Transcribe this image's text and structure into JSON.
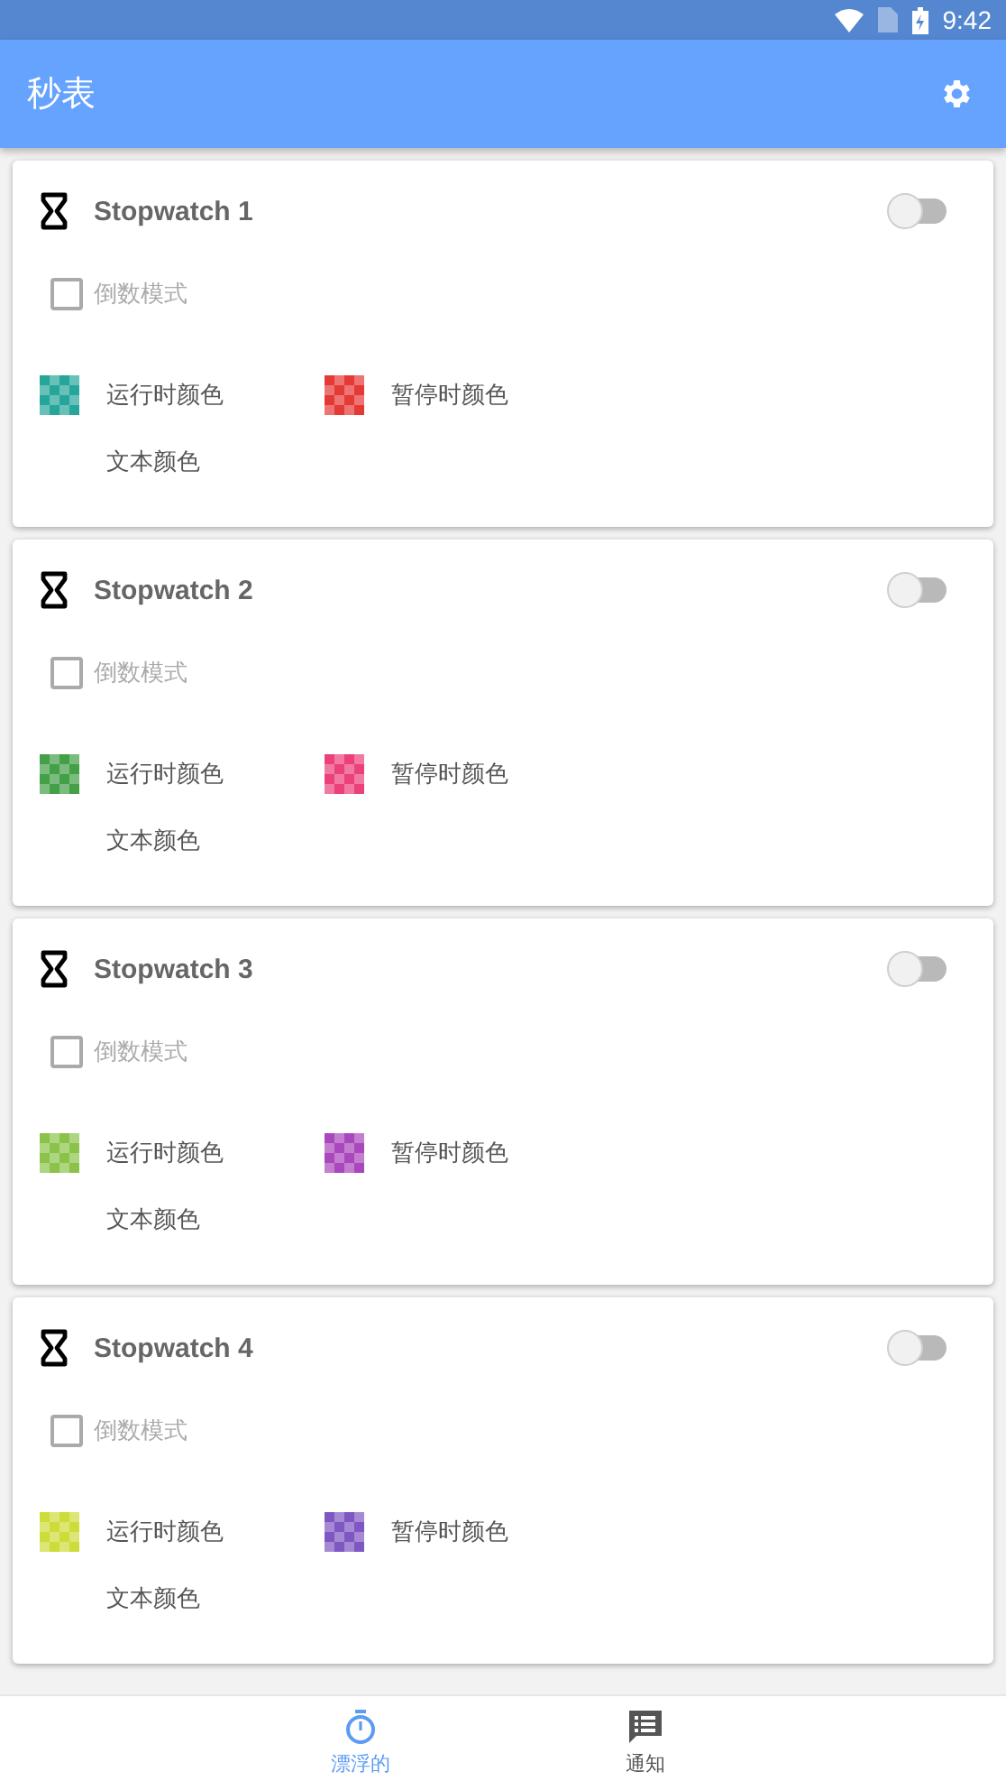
{
  "status_bar": {
    "time": "9:42"
  },
  "app_bar": {
    "title": "秒表"
  },
  "stopwatches": [
    {
      "title": "Stopwatch 1",
      "on": false,
      "countdown": {
        "label": "倒数模式",
        "checked": false,
        "disabled": true
      },
      "run_swatch": {
        "label": "运行时颜色",
        "color": "#26a69a"
      },
      "pause_swatch": {
        "label": "暂停时颜色",
        "color": "#e53935"
      },
      "text_color_label": "文本颜色"
    },
    {
      "title": "Stopwatch 2",
      "on": false,
      "countdown": {
        "label": "倒数模式",
        "checked": false,
        "disabled": true
      },
      "run_swatch": {
        "label": "运行时颜色",
        "color": "#43a047"
      },
      "pause_swatch": {
        "label": "暂停时颜色",
        "color": "#ec407a"
      },
      "text_color_label": "文本颜色"
    },
    {
      "title": "Stopwatch 3",
      "on": false,
      "countdown": {
        "label": "倒数模式",
        "checked": false,
        "disabled": true
      },
      "run_swatch": {
        "label": "运行时颜色",
        "color": "#8bc34a"
      },
      "pause_swatch": {
        "label": "暂停时颜色",
        "color": "#ab47bc"
      },
      "text_color_label": "文本颜色"
    },
    {
      "title": "Stopwatch 4",
      "on": false,
      "countdown": {
        "label": "倒数模式",
        "checked": false,
        "disabled": true
      },
      "run_swatch": {
        "label": "运行时颜色",
        "color": "#cddc39"
      },
      "pause_swatch": {
        "label": "暂停时颜色",
        "color": "#7e57c2"
      },
      "text_color_label": "文本颜色"
    }
  ],
  "bottom_nav": [
    {
      "kind": "timer",
      "label": "漂浮的",
      "selected": true
    },
    {
      "kind": "message",
      "label": "通知",
      "selected": false
    }
  ]
}
